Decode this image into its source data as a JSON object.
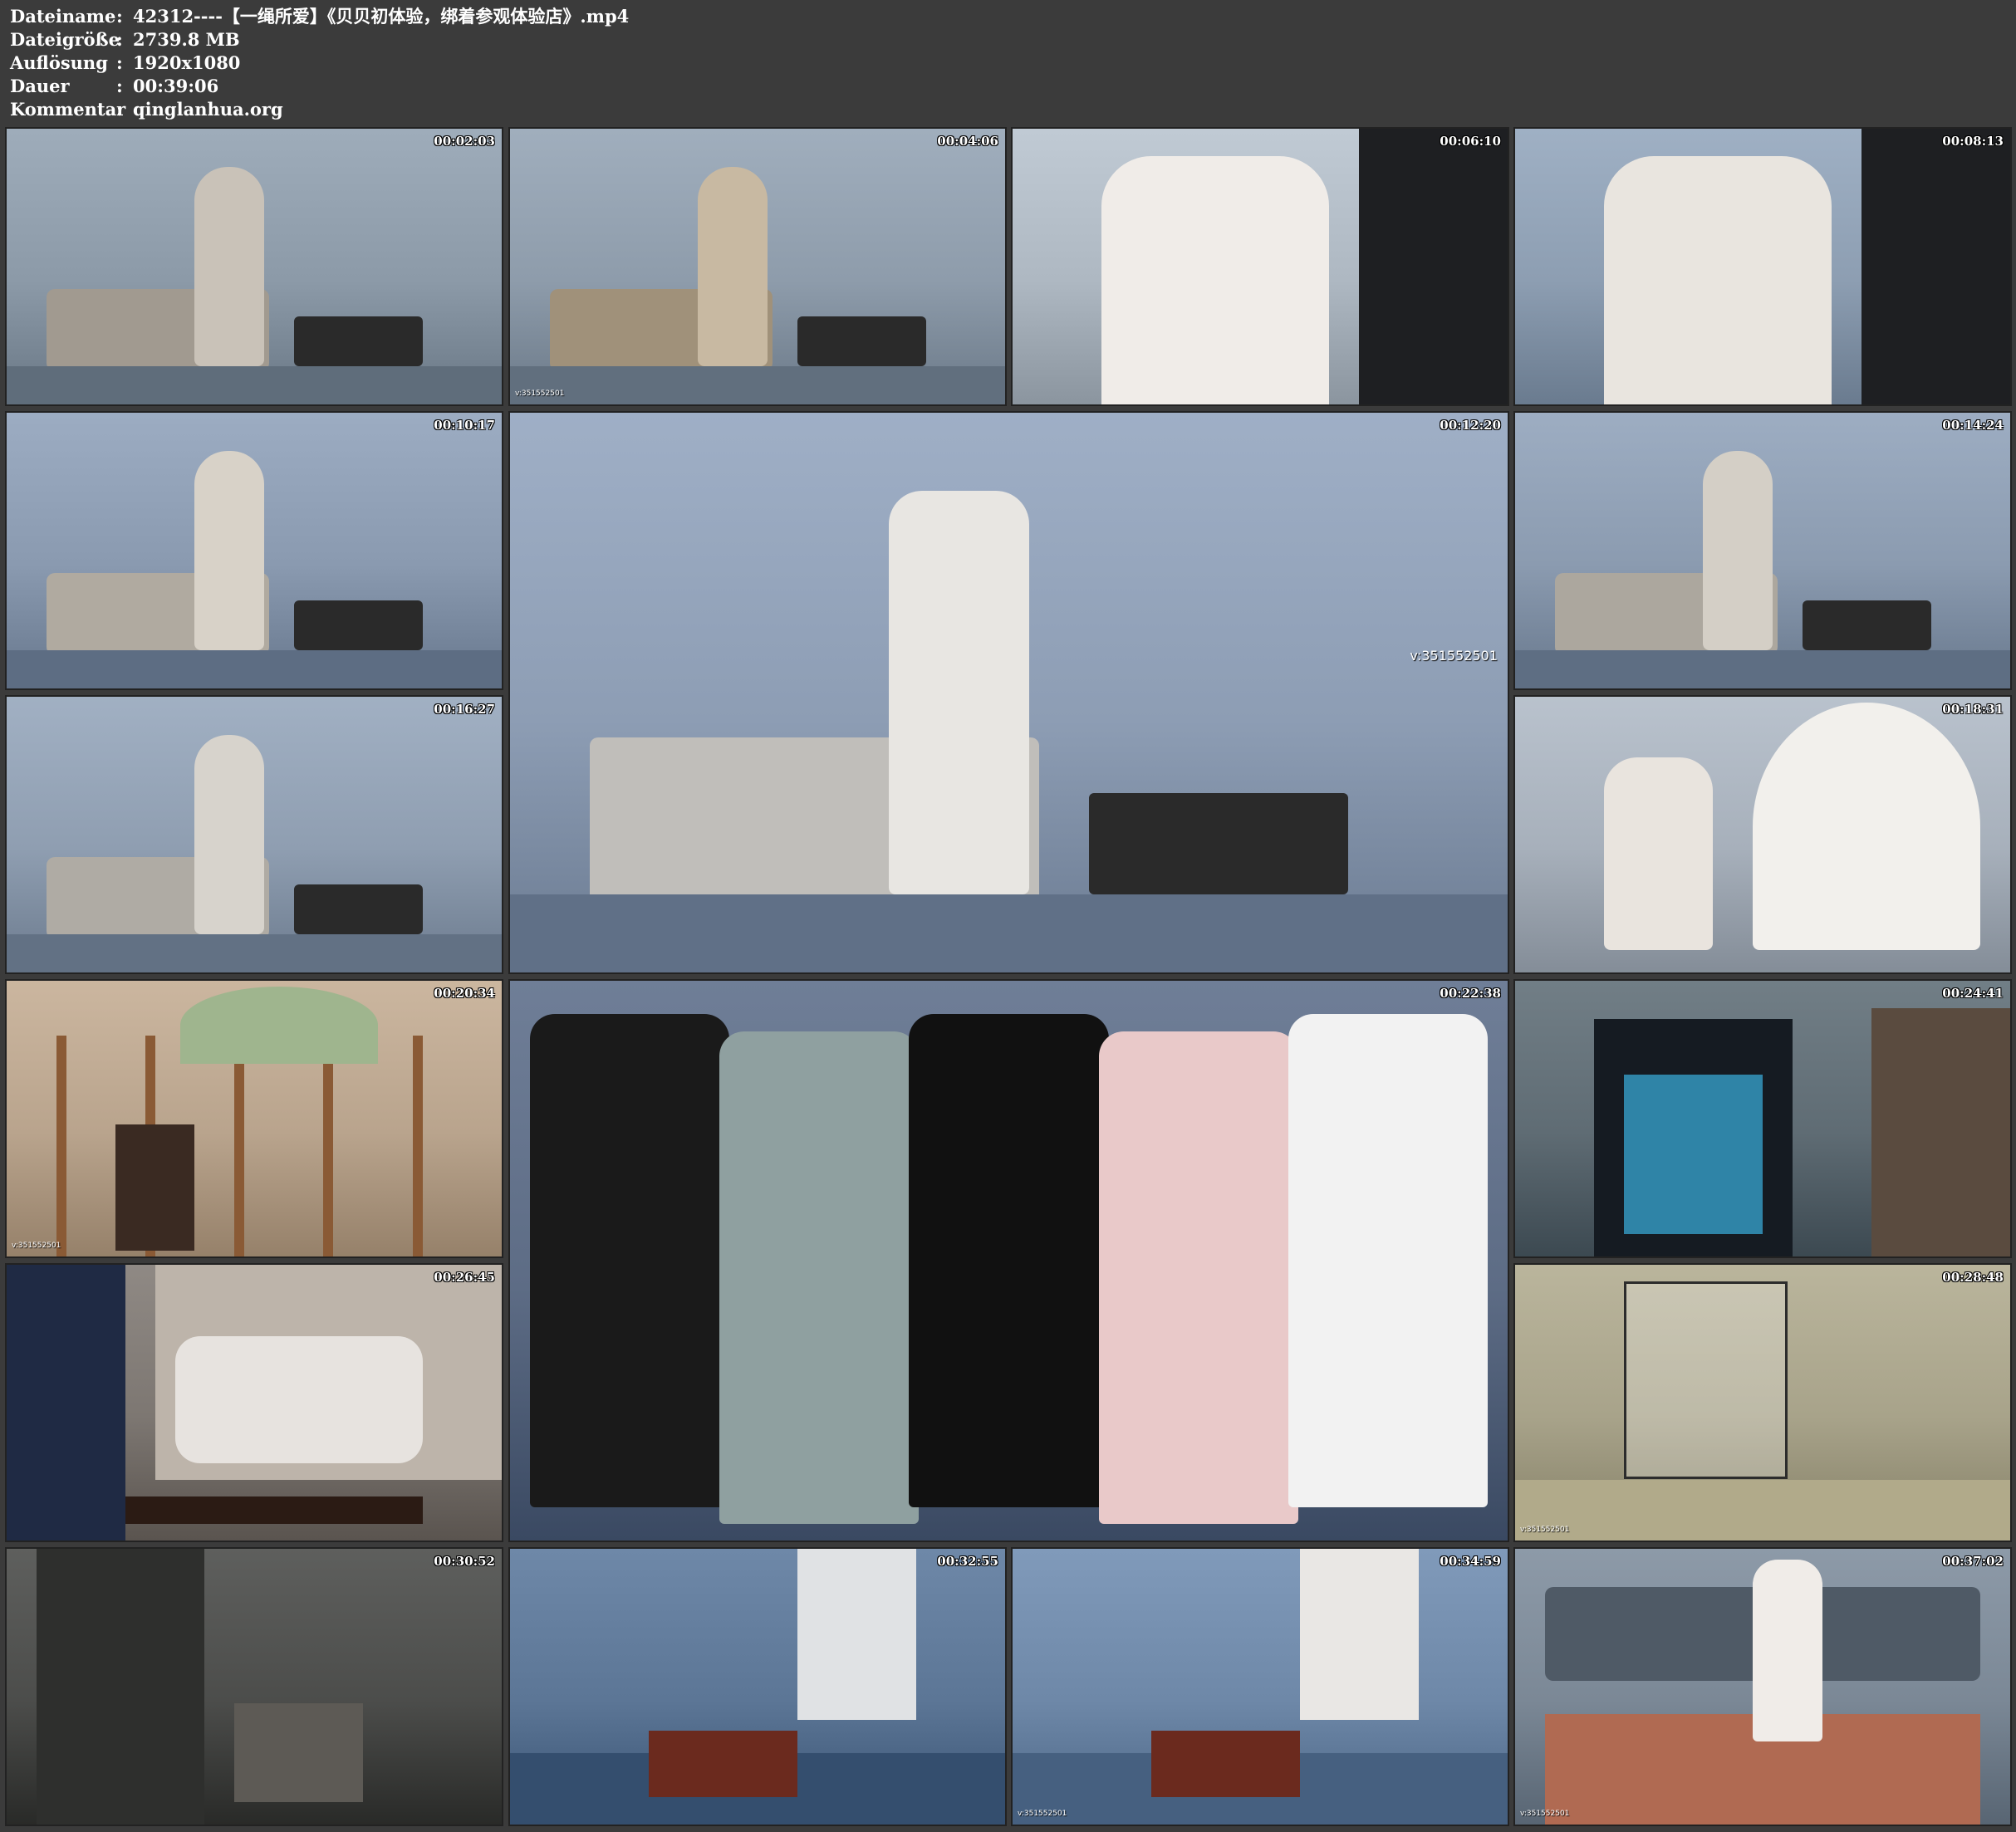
{
  "info": [
    {
      "label": "Dateiname",
      "value": "42312----【一绳所爱】《贝贝初体验，绑着参观体验店》.mp4"
    },
    {
      "label": "Dateigröße",
      "value": "2739.8 MB"
    },
    {
      "label": "Auflösung",
      "value": "1920x1080"
    },
    {
      "label": "Dauer",
      "value": "00:39:06"
    },
    {
      "label": "Kommentar",
      "value": "qinglanhua.org"
    }
  ],
  "separator": ":",
  "thumbnails": [
    {
      "timestamp": "00:02:03",
      "scene": "living-room",
      "bg": "#8c9aa8",
      "accent": "#c9c2b8"
    },
    {
      "timestamp": "00:04:06",
      "scene": "living-room",
      "bg": "#8e9cab",
      "accent": "#c8b9a2",
      "watermark": "v:351552501"
    },
    {
      "timestamp": "00:06:10",
      "scene": "closeup",
      "bg": "#aeb8c2",
      "accent": "#f0ece8"
    },
    {
      "timestamp": "00:08:13",
      "scene": "closeup",
      "bg": "#8d9eb2",
      "accent": "#e9e5df"
    },
    {
      "timestamp": "00:10:17",
      "scene": "living-room",
      "bg": "#8a9ab0",
      "accent": "#d8d2c8"
    },
    {
      "timestamp": "00:12:20",
      "scene": "main",
      "bg": "#8d9db4",
      "accent": "#e8e6e2",
      "watermark": "v:351552501"
    },
    {
      "timestamp": "00:14:24",
      "scene": "living-room",
      "bg": "#8b9bb0",
      "accent": "#d4cfc6"
    },
    {
      "timestamp": "00:16:27",
      "scene": "living-room",
      "bg": "#8f9eb1",
      "accent": "#d7d3cc"
    },
    {
      "timestamp": "00:18:31",
      "scene": "fan",
      "bg": "#a7b0bb",
      "accent": "#f2f0ec"
    },
    {
      "timestamp": "00:20:34",
      "scene": "japanese-room",
      "bg": "#b9a48d",
      "accent": "#e7d9c4",
      "watermark": "v:351552501"
    },
    {
      "timestamp": "00:22:38",
      "scene": "clothes",
      "bg": "#5d6c85",
      "accent": "#8fa3b7"
    },
    {
      "timestamp": "00:24:41",
      "scene": "cabinet",
      "bg": "#5f6c74",
      "accent": "#3ab0e0"
    },
    {
      "timestamp": "00:26:45",
      "scene": "brick-wall",
      "bg": "#7d7772",
      "accent": "#bdb4aa"
    },
    {
      "timestamp": "00:28:48",
      "scene": "cage-room",
      "bg": "#a8a38a",
      "accent": "#cfc8a8",
      "watermark": "v:351552501"
    },
    {
      "timestamp": "00:30:52",
      "scene": "dark-room",
      "bg": "#4c4d4b",
      "accent": "#6f6d68"
    },
    {
      "timestamp": "00:32:55",
      "scene": "blue-room",
      "bg": "#5c7696",
      "accent": "#e0e2e4"
    },
    {
      "timestamp": "00:34:59",
      "scene": "blue-room",
      "bg": "#6e88a8",
      "accent": "#e9e7e4",
      "watermark": "v:351552501"
    },
    {
      "timestamp": "00:37:02",
      "scene": "carpet-room",
      "bg": "#7b8896",
      "accent": "#b06a52",
      "watermark": "v:351552501"
    }
  ]
}
